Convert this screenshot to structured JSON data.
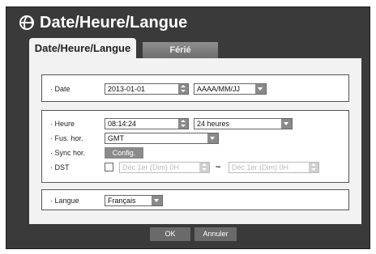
{
  "window": {
    "title": "Date/Heure/Langue"
  },
  "tabs": [
    {
      "label": "Date/Heure/Langue",
      "active": true
    },
    {
      "label": "Férié",
      "active": false
    }
  ],
  "date_group": {
    "date_label": "· Date",
    "date_value": "2013-01-01",
    "format_value": "AAAA/MM/JJ"
  },
  "time_group": {
    "heure_label": "· Heure",
    "heure_value": "08:14:24",
    "heure_format_value": "24 heures",
    "fus_label": "· Fus. hor.",
    "fus_value": "GMT",
    "sync_label": "· Sync hor.",
    "sync_button": "Config.",
    "dst_label": "· DST",
    "dst_checked": false,
    "dst_start": "Déc 1er (Dim) 0H",
    "dst_separator": "~",
    "dst_end": "Déc 1er (Dim) 0H"
  },
  "lang_group": {
    "langue_label": "· Langue",
    "langue_value": "Français"
  },
  "footer": {
    "ok_label": "OK",
    "cancel_label": "Annuler"
  },
  "colors": {
    "dialog_bg": "#3a3a3a",
    "panel_bg": "#f2f2f2",
    "control_gray": "#8a8a8a"
  }
}
